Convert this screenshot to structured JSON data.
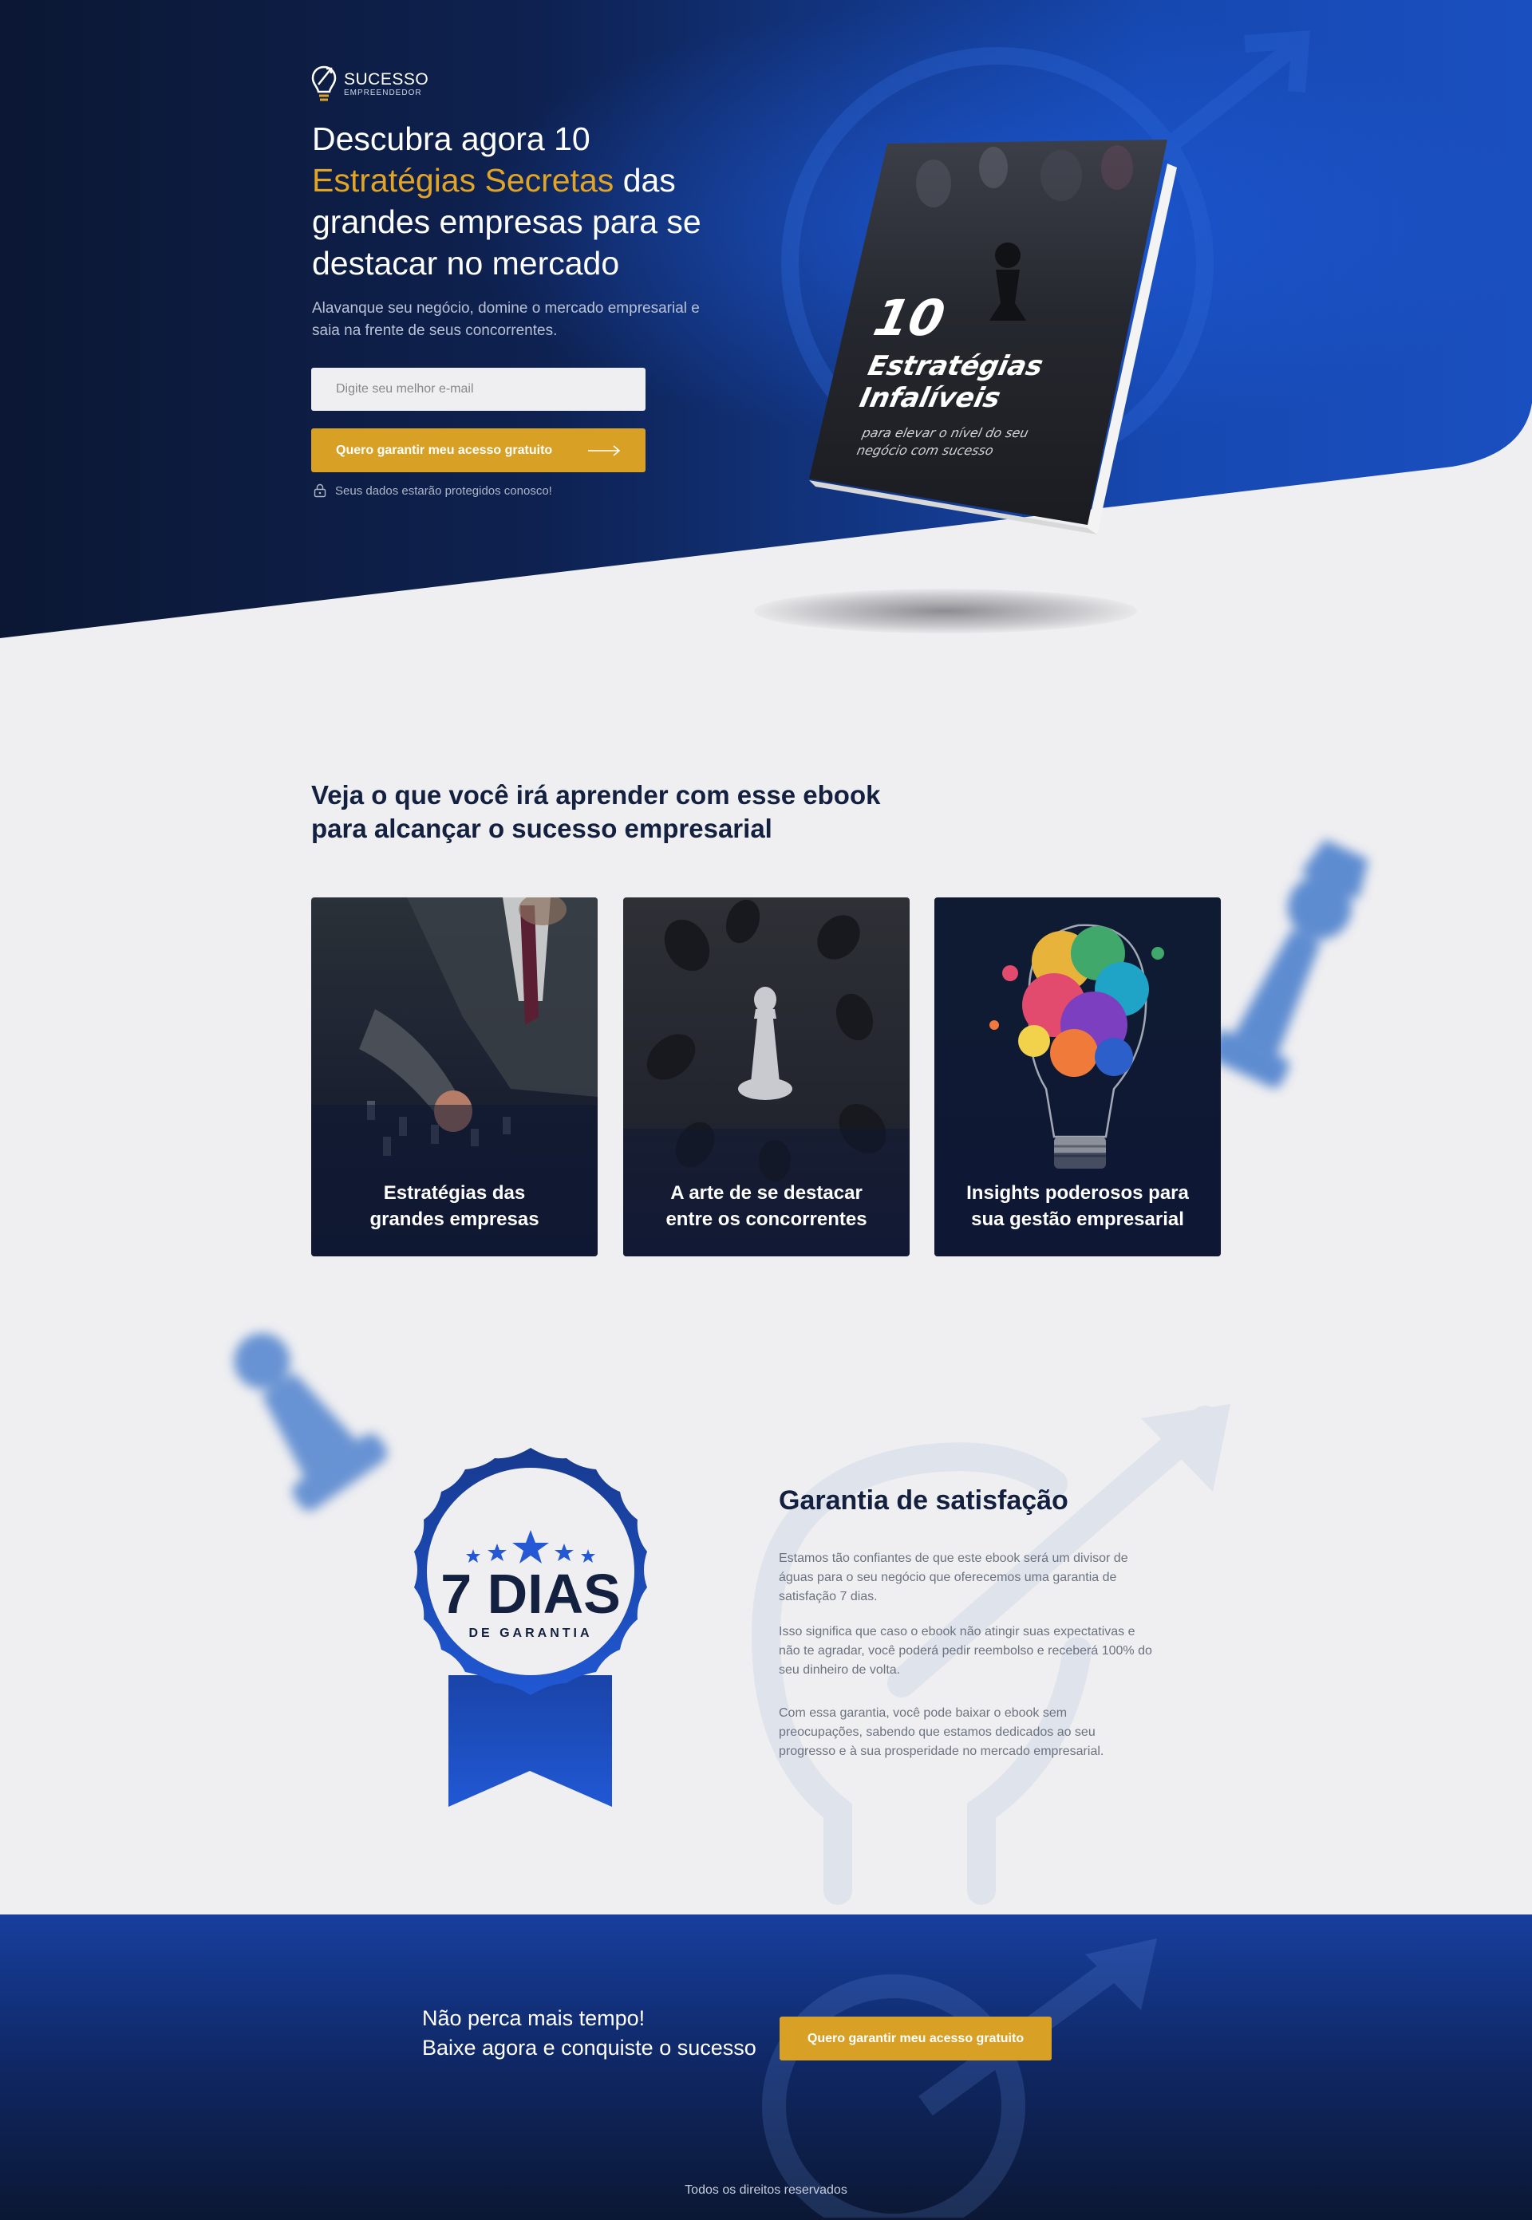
{
  "brand": {
    "name": "SUCESSO",
    "tagline": "EMPREENDEDOR"
  },
  "hero": {
    "title_part1": "Descubra agora 10",
    "title_accent": "Estratégias Secretas",
    "title_part2": " das grandes empresas para se destacar no mercado",
    "subtitle": "Alavanque seu negócio, domine o mercado empresarial e saia na frente de seus concorrentes.",
    "email_placeholder": "Digite seu melhor e-mail",
    "cta_label": "Quero garantir meu acesso gratuito",
    "privacy_text": "Seus dados estarão protegidos conosco!"
  },
  "book": {
    "number": "10",
    "title_line1": "Estratégias",
    "title_line2": "Infalíveis",
    "subtitle_line1": "para elevar o nível do seu",
    "subtitle_line2": "negócio com sucesso"
  },
  "learn": {
    "title_line1": "Veja o que você irá aprender com esse ebook",
    "title_line2": "para alcançar o sucesso empresarial",
    "cards": [
      {
        "line1": "Estratégias das",
        "line2": "grandes empresas"
      },
      {
        "line1": "A arte de se destacar",
        "line2": "entre os concorrentes"
      },
      {
        "line1": "Insights poderosos para",
        "line2": "sua gestão empresarial"
      }
    ]
  },
  "guarantee": {
    "badge_number": "7 DIAS",
    "badge_sub": "DE GARANTIA",
    "title": "Garantia de satisfação",
    "paragraphs": [
      "Estamos tão confiantes de que este ebook será um divisor de águas para o seu negócio que oferecemos uma garantia de satisfação 7 dias.",
      "Isso significa que caso o ebook não atingir suas expectativas e não te agradar, você poderá pedir reembolso e receberá 100% do seu dinheiro de volta.",
      "Com essa garantia, você pode baixar o ebook sem preocupações, sabendo que estamos dedicados ao seu progresso e à sua prosperidade no mercado empresarial."
    ]
  },
  "final_cta": {
    "line1": "Não perca mais tempo!",
    "line2": "Baixe agora e conquiste o sucesso",
    "button_label": "Quero garantir meu acesso gratuito"
  },
  "footer": {
    "copyright": "Todos os direitos reservados"
  },
  "colors": {
    "navy": "#0d1a3a",
    "blue": "#1a4fc0",
    "accent_gold": "#d9a026",
    "background": "#efeff1"
  }
}
